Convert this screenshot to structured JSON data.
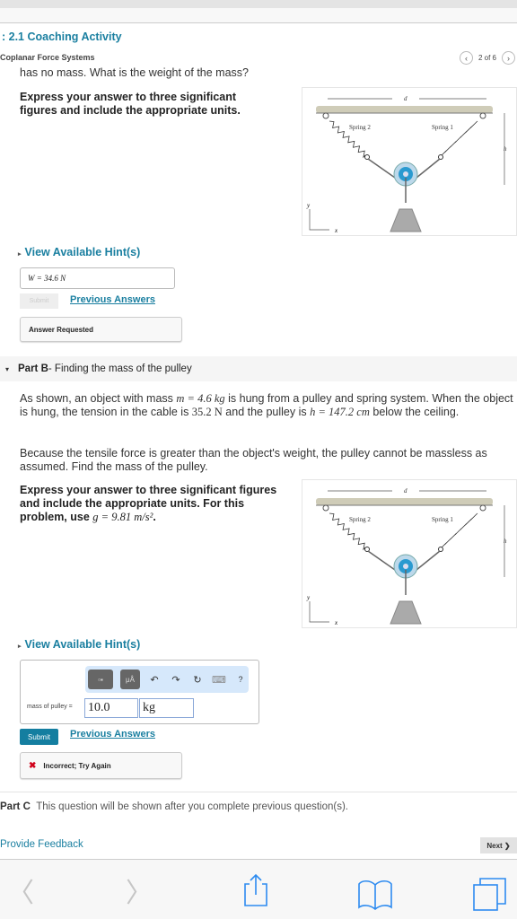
{
  "header": {
    "title": ": 2.1 Coaching Activity",
    "subtitle": "Coplanar Force Systems",
    "pager": "2 of 6"
  },
  "partA": {
    "question_tail": "has no mass. What is the weight of the mass?",
    "instruction": "Express your answer to three significant figures and include the appropriate units.",
    "hint_label": "View Available Hint(s)",
    "answer_value": "W =  34.6 N",
    "submit_label": "Submit",
    "submit_enabled": false,
    "previous_answers": "Previous Answers",
    "status": "Answer Requested"
  },
  "diagram": {
    "d": "d",
    "h": "h",
    "y": "y",
    "x": "x",
    "spring1": "Spring 1",
    "spring2": "Spring 2"
  },
  "partB": {
    "label": "Part B",
    "title": " - Finding the mass of the pulley",
    "p1_a": "As shown, an object with mass ",
    "p1_m": "m = 4.6 kg",
    "p1_b": " is hung from a pulley and spring system. When the object is hung, the tension in the cable is ",
    "p1_t": "35.2 N",
    "p1_c": " and the pulley is ",
    "p1_h": "h = 147.2 cm",
    "p1_d": " below the ceiling.",
    "p2": "Because the tensile force is greater than the object's weight, the pulley cannot be massless as assumed. Find the mass of the pulley.",
    "instruction": "Express your answer to three significant figures and include the appropriate units. For this problem, use ",
    "g": "g = 9.81 m/s²",
    "g_end": ".",
    "hint_label": "View Available Hint(s)",
    "toolbar": {
      "templates": "▫▪",
      "units": "μÅ",
      "undo": "↶",
      "redo": "↷",
      "reset": "↻",
      "keyboard": "⌨",
      "help": "?"
    },
    "input_label": "mass of pulley =",
    "value": "10.0",
    "unit": "kg",
    "submit_label": "Submit",
    "previous_answers": "Previous Answers",
    "status_icon": "✖",
    "status": "Incorrect; Try Again"
  },
  "partC": {
    "label": "Part C",
    "text": "This question will be shown after you complete previous question(s)."
  },
  "footer": {
    "feedback": "Provide Feedback",
    "next": "Next ❯"
  },
  "browser": {
    "back": "〈",
    "forward": "〉"
  },
  "colors": {
    "accent": "#1a7fa0",
    "ios_blue": "#2d8bf0",
    "error": "#d0021b"
  }
}
